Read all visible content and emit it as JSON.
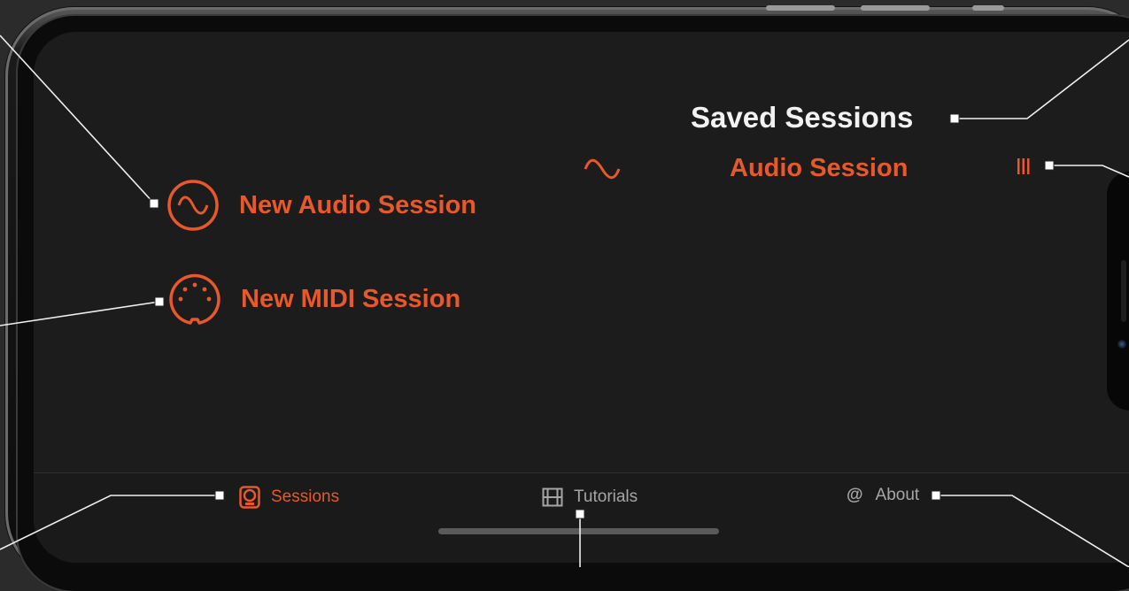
{
  "main": {
    "new_audio_label": "New Audio Session",
    "new_midi_label": "New MIDI Session"
  },
  "saved": {
    "title": "Saved Sessions",
    "sessions": [
      {
        "name": "Audio Session",
        "type_icon": "sine-wave-icon",
        "handle_icon": "drag-handle-icon"
      }
    ]
  },
  "tabbar": {
    "tabs": [
      {
        "label": "Sessions",
        "icon": "sessions-icon",
        "active": true
      },
      {
        "label": "Tutorials",
        "icon": "film-icon",
        "active": false
      },
      {
        "label": "About",
        "icon": "at-icon",
        "active": false
      }
    ]
  },
  "colors": {
    "accent": "#e8582a",
    "background": "#1c1c1c",
    "title": "#f2f2f2",
    "tab_inactive": "#a6a6a6"
  }
}
